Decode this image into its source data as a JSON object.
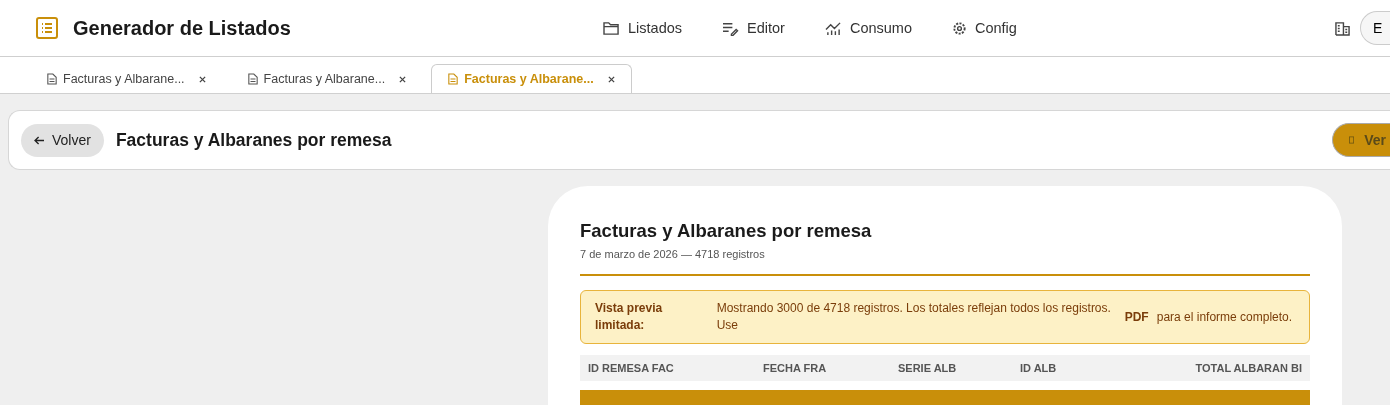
{
  "app": {
    "title": "Generador de Listados"
  },
  "nav": [
    {
      "label": "Listados"
    },
    {
      "label": "Editor"
    },
    {
      "label": "Consumo"
    },
    {
      "label": "Config"
    }
  ],
  "account": {
    "label": "E"
  },
  "tabs": [
    {
      "label": "Facturas y Albarane...",
      "selected": false
    },
    {
      "label": "Facturas y Albarane...",
      "selected": false
    },
    {
      "label": "Facturas y Albarane...",
      "selected": true
    }
  ],
  "toolbar": {
    "back": "Volver",
    "title": "Facturas y Albaranes por remesa",
    "action": "Ver"
  },
  "report": {
    "title": "Facturas y Albaranes por remesa",
    "subtitle": "7 de marzo de 2026 — 4718 registros",
    "notice": {
      "label": "Vista previa limitada:",
      "message": "Mostrando 3000 de 4718 registros. Los totales reflejan todos los registros. Use",
      "link": "PDF",
      "suffix": "para el informe completo."
    },
    "columns": [
      "ID REMESA FAC",
      "FECHA FRA",
      "SERIE ALB",
      "ID ALB",
      "TOTAL ALBARAN BI"
    ]
  }
}
